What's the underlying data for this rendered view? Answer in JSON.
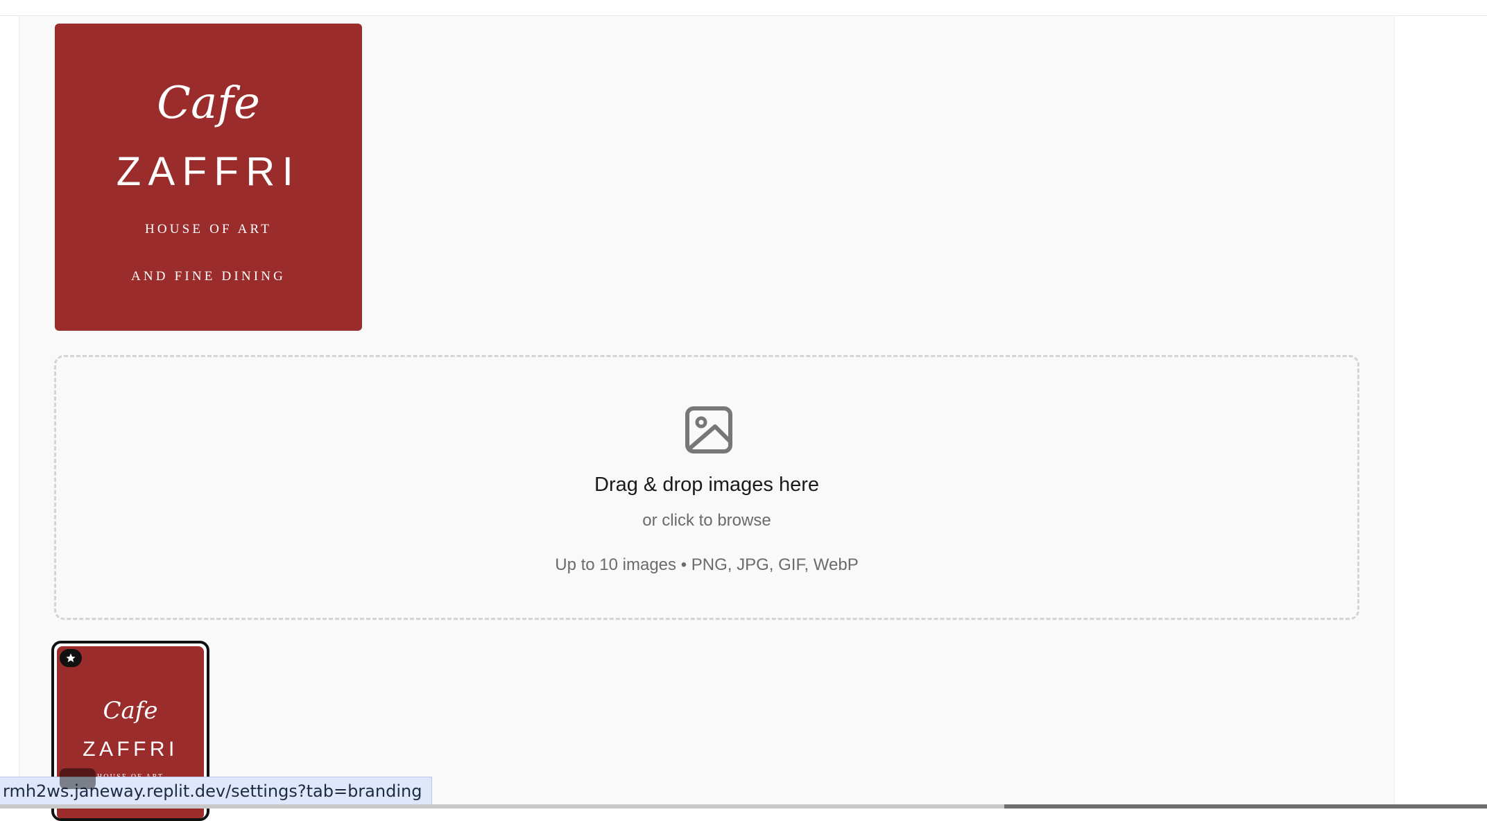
{
  "logo": {
    "script_text": "Cafe",
    "brand_text": "ZAFFRI",
    "tagline_line1": "HOUSE of ART",
    "tagline_line2": "and FINE DINING",
    "background_color": "#9b2c2c"
  },
  "dropzone": {
    "icon": "image-icon",
    "title": "Drag & drop images here",
    "subtitle": "or click to browse",
    "hint": "Up to 10 images • PNG, JPG, GIF, WebP"
  },
  "thumbnails": [
    {
      "primary_icon": "star-icon",
      "script_text": "Cafe",
      "brand_text": "ZAFFRI",
      "tagline_line1": "HOUSE of ART",
      "selected": true
    }
  ],
  "status_bar": {
    "url": "rmh2ws.janeway.replit.dev/settings?tab=branding"
  }
}
